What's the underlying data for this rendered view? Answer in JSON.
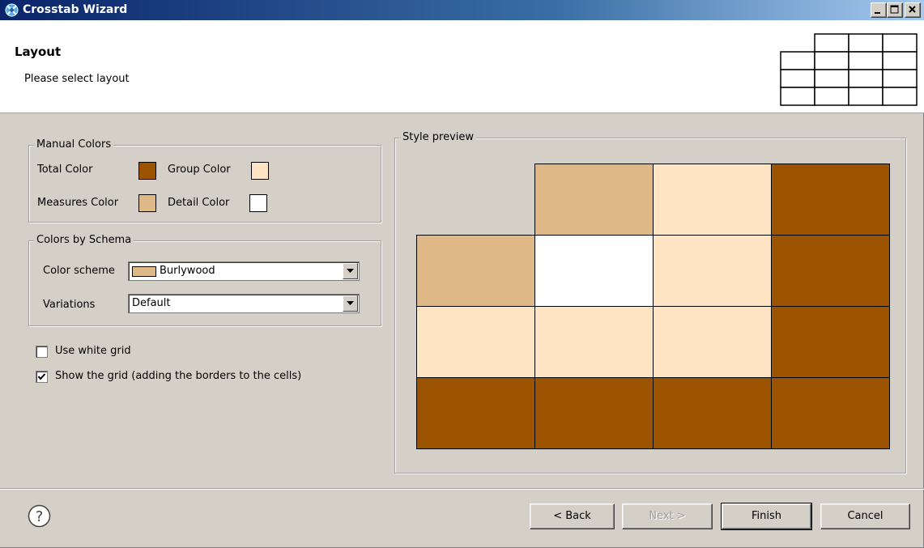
{
  "window": {
    "title": "Crosstab Wizard"
  },
  "header": {
    "title": "Layout",
    "description": "Please select layout"
  },
  "manual_colors": {
    "label": "Manual Colors",
    "total_color_label": "Total Color",
    "group_color_label": "Group Color",
    "measures_color_label": "Measures Color",
    "detail_color_label": "Detail Color",
    "colors": {
      "total": "#9c5300",
      "group": "#ffe4c4",
      "measures": "#deb887",
      "detail": "#ffffff"
    }
  },
  "colors_by_schema": {
    "label": "Colors by Schema",
    "color_scheme_label": "Color scheme",
    "color_scheme_value": "Burlywood",
    "variations_label": "Variations",
    "variations_value": "Default"
  },
  "options": {
    "use_white_grid": {
      "label": "Use white grid",
      "checked": false
    },
    "show_grid": {
      "label": "Show the grid (adding the borders to the cells)",
      "checked": true
    }
  },
  "preview": {
    "label": "Style preview",
    "rows": [
      [
        null,
        "#deb887",
        "#ffe4c4",
        "#9c5300"
      ],
      [
        "#deb887",
        "#ffffff",
        "#ffe4c4",
        "#9c5300"
      ],
      [
        "#ffe4c4",
        "#ffe4c4",
        "#ffe4c4",
        "#9c5300"
      ],
      [
        "#9c5300",
        "#9c5300",
        "#9c5300",
        "#9c5300"
      ]
    ]
  },
  "footer": {
    "back_label": "< Back",
    "next_label": "Next >",
    "finish_label": "Finish",
    "cancel_label": "Cancel"
  },
  "icons": {
    "help": "help-icon",
    "app": "crosstab-wizard-icon"
  }
}
